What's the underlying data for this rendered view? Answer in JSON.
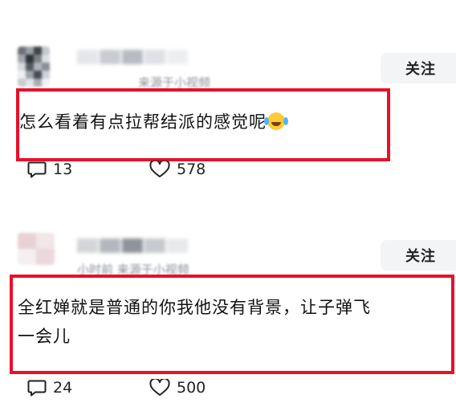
{
  "posts": [
    {
      "meta": "来源于小视频",
      "follow_label": "关注",
      "comment": "怎么看着有点拉帮结派的感觉呢",
      "emoji": "laughing-crying-emoji",
      "comments_count": "13",
      "likes_count": "578"
    },
    {
      "meta": "小时前 来源于小视频",
      "follow_label": "关注",
      "comment_line1": "全红婵就是普通的你我他没有背景，让子弹飞",
      "comment_line2": "一会儿",
      "comments_count": "24",
      "likes_count": "500"
    }
  ],
  "colors": {
    "highlight": "#e8102a",
    "follow_bg": "#f3f4f6",
    "muted_text": "#8a8f99"
  },
  "icons": {
    "comment": "comment-bubble-icon",
    "like": "heart-outline-icon"
  }
}
